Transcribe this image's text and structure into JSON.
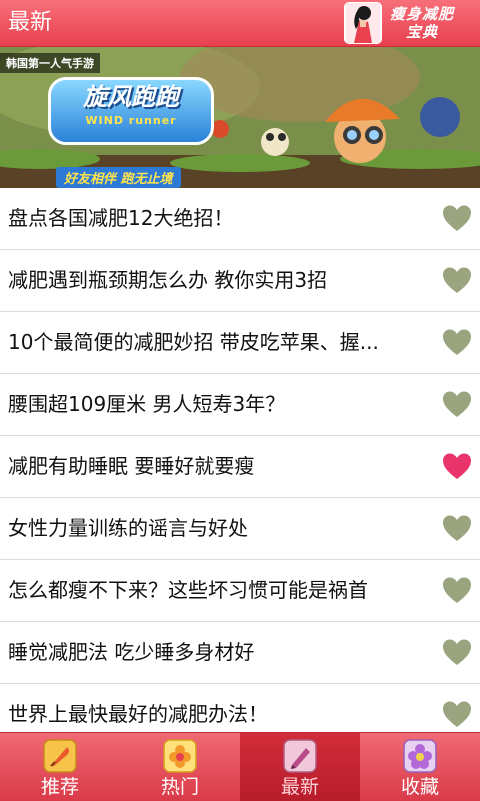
{
  "header": {
    "title": "最新",
    "logo_text_line1": "瘦身减肥",
    "logo_text_line2": "宝典"
  },
  "banner": {
    "tag": "韩国第一人气手游",
    "game_title_cn": "旋风跑跑",
    "game_title_en": "WIND runner",
    "slogan": "好友相伴  跑无止境"
  },
  "articles": [
    {
      "title": "盘点各国减肥12大绝招！",
      "favorited": false
    },
    {
      "title": "减肥遇到瓶颈期怎么办 教你实用3招",
      "favorited": false
    },
    {
      "title": "10个最简便的减肥妙招 带皮吃苹果、握...",
      "favorited": false
    },
    {
      "title": "腰围超109厘米 男人短寿3年？",
      "favorited": false
    },
    {
      "title": "减肥有助睡眠 要睡好就要瘦",
      "favorited": true
    },
    {
      "title": "女性力量训练的谣言与好处",
      "favorited": false
    },
    {
      "title": "怎么都瘦不下来？这些坏习惯可能是祸首",
      "favorited": false
    },
    {
      "title": "睡觉减肥法 吃少睡多身材好",
      "favorited": false
    },
    {
      "title": "世界上最快最好的减肥办法！",
      "favorited": false
    }
  ],
  "tabs": [
    {
      "label": "推荐",
      "icon": "quill-icon",
      "active": false
    },
    {
      "label": "热门",
      "icon": "flower-icon",
      "active": false
    },
    {
      "label": "最新",
      "icon": "pen-icon",
      "active": true
    },
    {
      "label": "收藏",
      "icon": "star-flower-icon",
      "active": false
    }
  ],
  "colors": {
    "accent": "#e8404e",
    "heart_default": "#9aa580",
    "heart_active": "#e8346a"
  }
}
